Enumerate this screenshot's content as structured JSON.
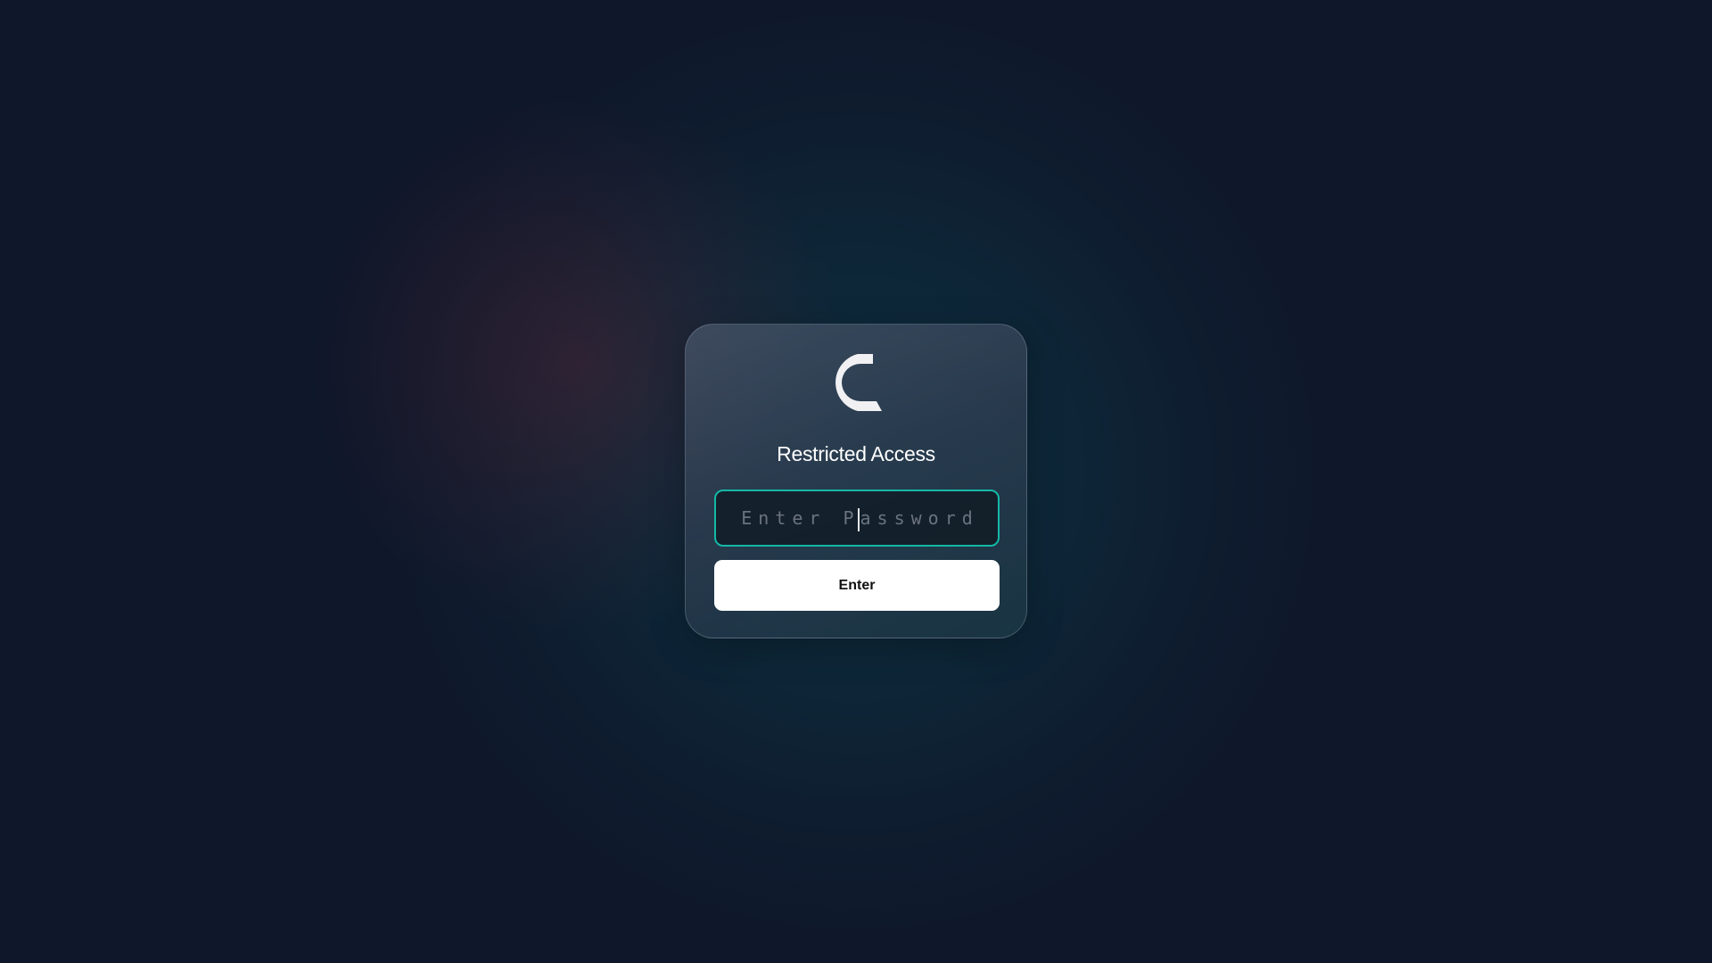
{
  "logo": {
    "icon": "c-logo-icon",
    "color": "#f1f1f3"
  },
  "title": "Restricted Access",
  "password": {
    "placeholder": "Enter Password",
    "value": ""
  },
  "enter_button": {
    "label": "Enter"
  },
  "colors": {
    "background": "#0f172a",
    "accent": "#14b8a6",
    "button_bg": "#ffffff",
    "button_text": "#111111"
  }
}
